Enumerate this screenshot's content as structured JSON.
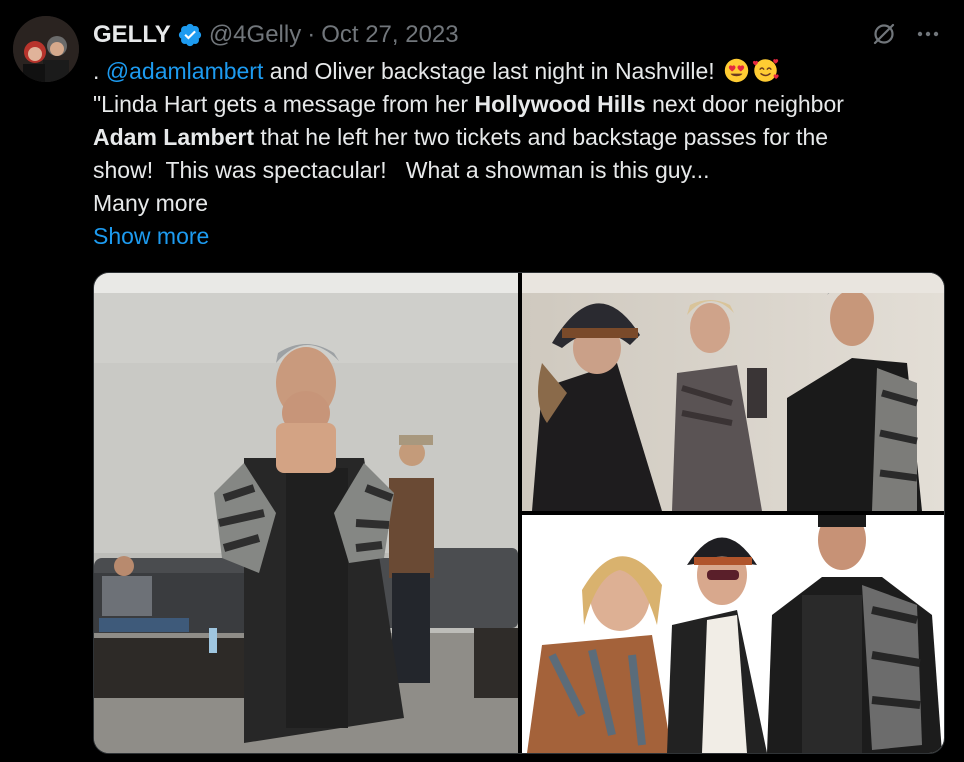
{
  "author": {
    "name": "GELLY",
    "handle": "@4Gelly",
    "separator": "·",
    "date": "Oct 27, 2023",
    "verified_icon": "verified-badge-icon",
    "verified_color": "#1d9bf0"
  },
  "tweet": {
    "line1_prefix": ". ",
    "mention": "@adamlambert",
    "line1_rest": " and Oliver backstage last night in Nashville! ",
    "emoji1": "smiling-face-with-heart-eyes-icon",
    "emoji2": "smiling-face-with-hearts-icon",
    "line2_a": "\"Linda Hart gets a message from her ",
    "line2_bold": "Hollywood Hills",
    "line2_b": " next door neighbor",
    "line3_bold": "Adam Lambert",
    "line3_rest": " that he left her two tickets and backstage passes for the",
    "line4": "show!  This was spectacular!   What a showman is this guy...",
    "line5": "Many more",
    "show_more": "Show more"
  },
  "actions": {
    "grok_icon": "grok-icon",
    "more_icon": "more-options-icon"
  },
  "colors": {
    "background": "#000000",
    "text": "#e7e9ea",
    "secondary": "#71767b",
    "accent": "#1d9bf0"
  }
}
